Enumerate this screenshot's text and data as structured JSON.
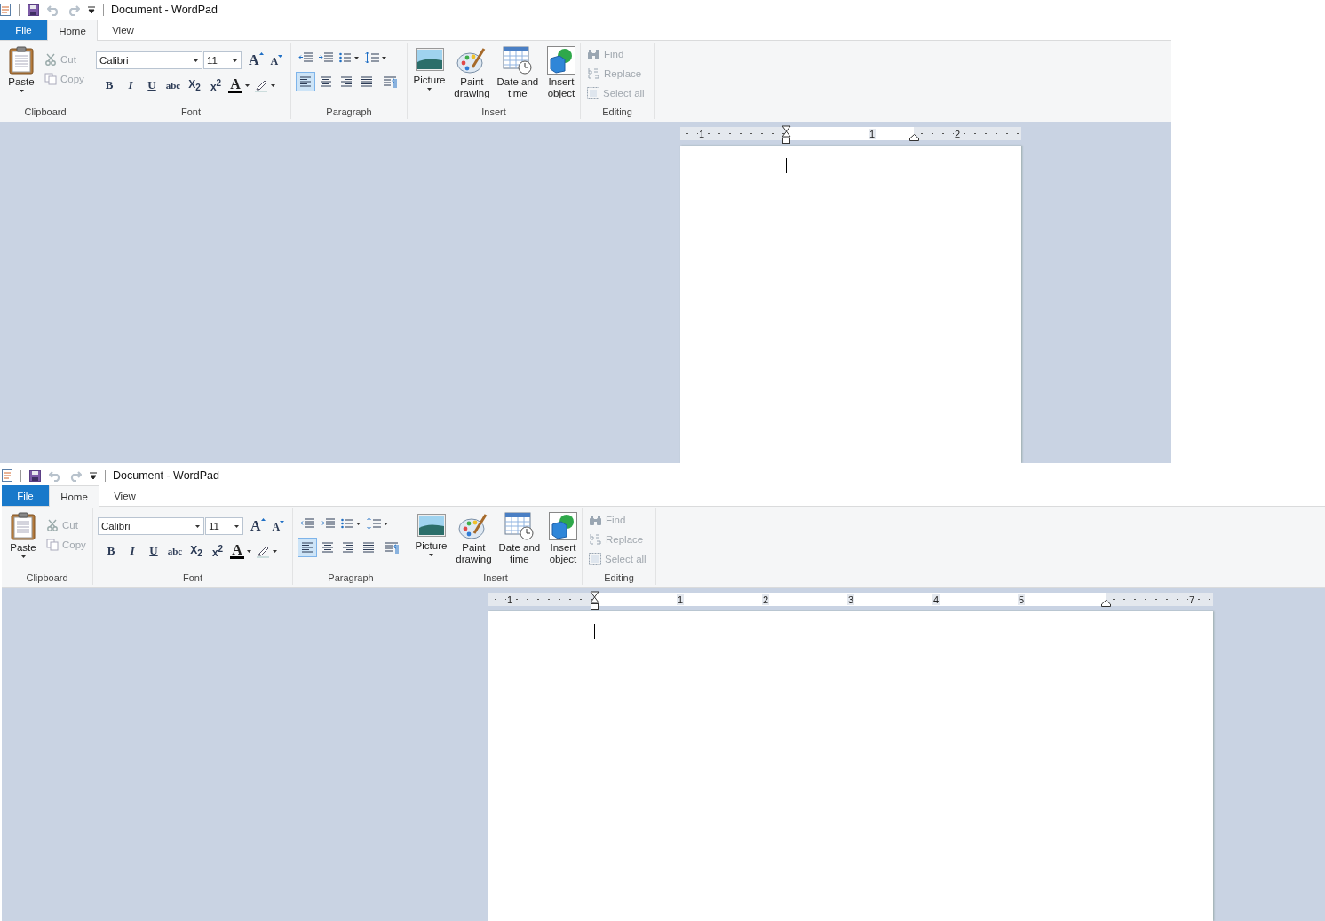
{
  "windows": [
    {
      "title": "Document - WordPad",
      "tabs": [
        {
          "label": "File",
          "kind": "file",
          "selected": false
        },
        {
          "label": "Home",
          "kind": "tab",
          "selected": true
        },
        {
          "label": "View",
          "kind": "tab",
          "selected": false
        }
      ],
      "clipboard": {
        "label": "Clipboard",
        "paste": "Paste",
        "items": [
          {
            "label": "Cut",
            "kind": "cut",
            "disabled": true
          },
          {
            "label": "Copy",
            "kind": "copy",
            "disabled": true
          }
        ]
      },
      "font": {
        "label": "Font",
        "family": "Calibri",
        "size": "11",
        "grow_glyph": "A",
        "shrink_glyph": "A",
        "color_glyph": "A",
        "styles": [
          {
            "glyph": "B",
            "kind": "bold"
          },
          {
            "glyph": "I",
            "kind": "italic"
          },
          {
            "glyph": "U",
            "kind": "underline"
          },
          {
            "glyph": "abc",
            "kind": "strike"
          },
          {
            "glyph": "X$_{2}$",
            "kind": "sub"
          },
          {
            "glyph": "x$^{2}$",
            "kind": "sup"
          }
        ]
      },
      "paragraph": {
        "label": "Paragraph",
        "alignments": [
          {
            "kind": "left",
            "selected": true
          },
          {
            "kind": "center",
            "selected": false
          },
          {
            "kind": "right",
            "selected": false
          },
          {
            "kind": "justify",
            "selected": false
          }
        ]
      },
      "insert": {
        "label": "Insert",
        "items": [
          {
            "label": "Picture",
            "kind": "picture",
            "dropdown": true
          },
          {
            "label": "Paint drawing",
            "kind": "paint",
            "dropdown": false
          },
          {
            "label": "Date and time",
            "kind": "datetime",
            "dropdown": false
          },
          {
            "label": "Insert object",
            "kind": "object",
            "dropdown": false
          }
        ]
      },
      "editing": {
        "label": "Editing",
        "items": [
          {
            "label": "Find",
            "kind": "find",
            "disabled": true
          },
          {
            "label": "Replace",
            "kind": "replace",
            "disabled": true
          },
          {
            "label": "Select all",
            "kind": "select",
            "disabled": true
          }
        ]
      },
      "ruler": {
        "labels": [
          "1",
          "1",
          "2"
        ]
      }
    },
    {
      "title": "Document - WordPad",
      "tabs": [
        {
          "label": "File",
          "kind": "file",
          "selected": false
        },
        {
          "label": "Home",
          "kind": "tab",
          "selected": true
        },
        {
          "label": "View",
          "kind": "tab",
          "selected": false
        }
      ],
      "clipboard": {
        "label": "Clipboard",
        "paste": "Paste",
        "items": [
          {
            "label": "Cut",
            "kind": "cut",
            "disabled": true
          },
          {
            "label": "Copy",
            "kind": "copy",
            "disabled": true
          }
        ]
      },
      "font": {
        "label": "Font",
        "family": "Calibri",
        "size": "11",
        "grow_glyph": "A",
        "shrink_glyph": "A",
        "color_glyph": "A",
        "styles": [
          {
            "glyph": "B",
            "kind": "bold"
          },
          {
            "glyph": "I",
            "kind": "italic"
          },
          {
            "glyph": "U",
            "kind": "underline"
          },
          {
            "glyph": "abc",
            "kind": "strike"
          },
          {
            "glyph": "X$_{2}$",
            "kind": "sub"
          },
          {
            "glyph": "x$^{2}$",
            "kind": "sup"
          }
        ]
      },
      "paragraph": {
        "label": "Paragraph",
        "alignments": [
          {
            "kind": "left",
            "selected": true
          },
          {
            "kind": "center",
            "selected": false
          },
          {
            "kind": "right",
            "selected": false
          },
          {
            "kind": "justify",
            "selected": false
          }
        ]
      },
      "insert": {
        "label": "Insert",
        "items": [
          {
            "label": "Picture",
            "kind": "picture",
            "dropdown": true
          },
          {
            "label": "Paint drawing",
            "kind": "paint",
            "dropdown": false
          },
          {
            "label": "Date and time",
            "kind": "datetime",
            "dropdown": false
          },
          {
            "label": "Insert object",
            "kind": "object",
            "dropdown": false
          }
        ]
      },
      "editing": {
        "label": "Editing",
        "items": [
          {
            "label": "Find",
            "kind": "find",
            "disabled": true
          },
          {
            "label": "Replace",
            "kind": "replace",
            "disabled": true
          },
          {
            "label": "Select all",
            "kind": "select",
            "disabled": true
          }
        ]
      },
      "ruler": {
        "labels": [
          "1",
          "1",
          "2",
          "3",
          "4",
          "5",
          "7"
        ]
      }
    }
  ]
}
